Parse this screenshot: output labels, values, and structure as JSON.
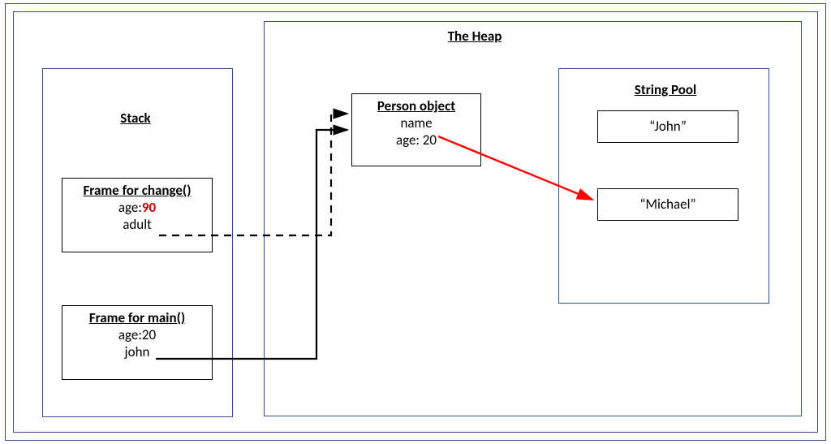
{
  "outer": {},
  "inner": {},
  "heap": {
    "title": "The Heap",
    "person": {
      "title": "Person object",
      "name_label": "name",
      "age_line": "age: 20"
    },
    "string_pool": {
      "title": "String Pool",
      "john": "“John”",
      "michael": "“Michael”"
    }
  },
  "stack": {
    "title": "Stack",
    "frame_change": {
      "title": "Frame for change()",
      "age_label": "age:",
      "age_value": "90",
      "adult_label": "adult"
    },
    "frame_main": {
      "title": "Frame for main()",
      "age_line": "age:20",
      "john_label": "john"
    }
  },
  "colors": {
    "blue_border": "#2f528f",
    "arrow_red": "#ff0000",
    "arrow_black": "#000000"
  }
}
